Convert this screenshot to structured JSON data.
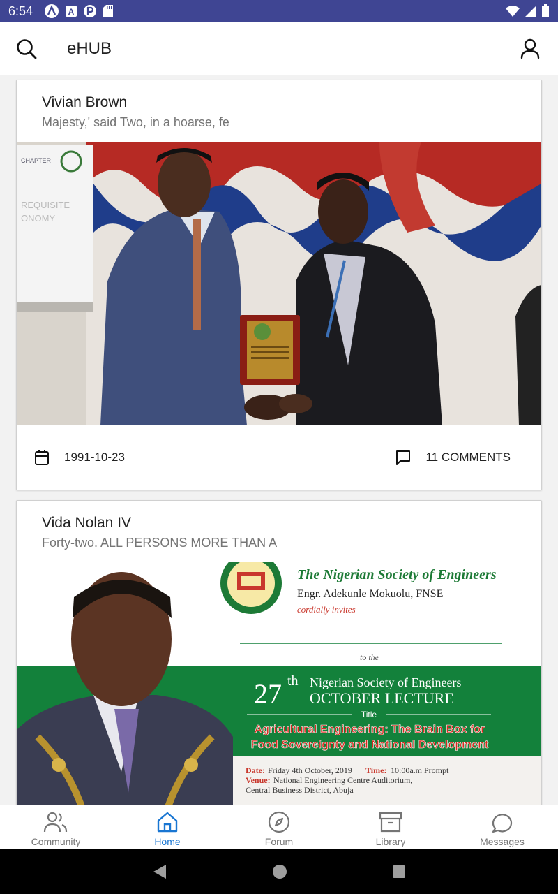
{
  "status_bar": {
    "time": "6:54",
    "icons": [
      "a-circle-icon",
      "a-square-icon",
      "p-circle-icon",
      "sd-card-icon"
    ],
    "right_icons": [
      "wifi-icon",
      "signal-icon",
      "battery-icon"
    ]
  },
  "app_bar": {
    "title": "eHUB",
    "left_icon": "search-icon",
    "right_icon": "profile-icon"
  },
  "posts": [
    {
      "author": "Vivian Brown",
      "excerpt": "Majesty,' said Two, in a hoarse, fe",
      "image_text": {
        "chapter": "CHAPTER",
        "bg_line1": "REQUISITE",
        "bg_line2": "ONOMY"
      },
      "date": "1991-10-23",
      "comments": "11 COMMENTS"
    },
    {
      "author": "Vida Nolan IV",
      "excerpt": "Forty-two. ALL PERSONS MORE THAN A",
      "flyer": {
        "org": "The Nigerian Society of Engineers",
        "president": "Engr. Adekunle Mokuolu, FNSE",
        "invite": "cordially invites",
        "to_the": "to the",
        "number": "27",
        "suffix": "th",
        "society": "Nigerian Society of Engineers",
        "lecture": "OCTOBER LECTURE",
        "title_label": "Title",
        "topic_line1": "Agricultural Engineering: The Brain Box for",
        "topic_line2": "Food Sovereignty and National Development",
        "date_label": "Date:",
        "date_value": "Friday 4th October, 2019",
        "time_label": "Time:",
        "time_value": "10:00a.m Prompt",
        "venue_label": "Venue:",
        "venue_line1": "National Engineering Centre Auditorium,",
        "venue_line2": "Central Business District, Abuja"
      }
    }
  ],
  "bottom_nav": [
    {
      "label": "Community",
      "icon": "community-icon",
      "active": false
    },
    {
      "label": "Home",
      "icon": "home-icon",
      "active": true
    },
    {
      "label": "Forum",
      "icon": "compass-icon",
      "active": false
    },
    {
      "label": "Library",
      "icon": "archive-icon",
      "active": false
    },
    {
      "label": "Messages",
      "icon": "chat-bubble-icon",
      "active": false
    }
  ],
  "colors": {
    "status_bar": "#3f4593",
    "active_nav": "#1976d2",
    "inactive_nav": "#757575",
    "flyer_green": "#13813b",
    "flyer_red": "#d62a1e"
  }
}
